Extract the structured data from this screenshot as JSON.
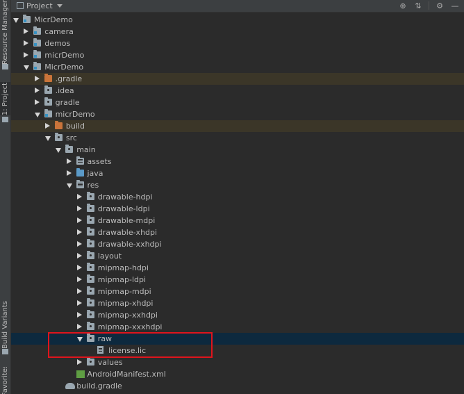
{
  "side_tabs": {
    "resource_manager": "Resource Manager",
    "project": "1: Project",
    "build_variants": "Build Variants",
    "favorites": "Favorites"
  },
  "header": {
    "title": "Project",
    "icons": [
      "crosshair-icon",
      "collapse-all-icon",
      "gear-icon"
    ]
  },
  "tree": [
    {
      "label": "MicrDemo",
      "icon": "module",
      "expanded": true
    },
    {
      "label": "camera",
      "icon": "module",
      "expanded": false
    },
    {
      "label": "demos",
      "icon": "module",
      "expanded": false
    },
    {
      "label": "micrDemo",
      "icon": "module",
      "expanded": false
    },
    {
      "label": "MicrDemo",
      "icon": "module",
      "expanded": true
    },
    {
      "label": ".gradle",
      "icon": "folder-excluded",
      "expanded": false
    },
    {
      "label": ".idea",
      "icon": "folder",
      "expanded": false
    },
    {
      "label": "gradle",
      "icon": "folder",
      "expanded": false
    },
    {
      "label": "micrDemo",
      "icon": "module",
      "expanded": true
    },
    {
      "label": "build",
      "icon": "folder-excluded",
      "expanded": false
    },
    {
      "label": "src",
      "icon": "folder",
      "expanded": true
    },
    {
      "label": "main",
      "icon": "folder",
      "expanded": true
    },
    {
      "label": "assets",
      "icon": "folder-resources",
      "expanded": false
    },
    {
      "label": "java",
      "icon": "folder-source",
      "expanded": false
    },
    {
      "label": "res",
      "icon": "folder-resources",
      "expanded": true
    },
    {
      "label": "drawable-hdpi",
      "icon": "folder",
      "expanded": false
    },
    {
      "label": "drawable-ldpi",
      "icon": "folder",
      "expanded": false
    },
    {
      "label": "drawable-mdpi",
      "icon": "folder",
      "expanded": false
    },
    {
      "label": "drawable-xhdpi",
      "icon": "folder",
      "expanded": false
    },
    {
      "label": "drawable-xxhdpi",
      "icon": "folder",
      "expanded": false
    },
    {
      "label": "layout",
      "icon": "folder",
      "expanded": false
    },
    {
      "label": "mipmap-hdpi",
      "icon": "folder",
      "expanded": false
    },
    {
      "label": "mipmap-ldpi",
      "icon": "folder",
      "expanded": false
    },
    {
      "label": "mipmap-mdpi",
      "icon": "folder",
      "expanded": false
    },
    {
      "label": "mipmap-xhdpi",
      "icon": "folder",
      "expanded": false
    },
    {
      "label": "mipmap-xxhdpi",
      "icon": "folder",
      "expanded": false
    },
    {
      "label": "mipmap-xxxhdpi",
      "icon": "folder",
      "expanded": false
    },
    {
      "label": "raw",
      "icon": "folder",
      "expanded": true,
      "selected": true
    },
    {
      "label": "license.lic",
      "icon": "file"
    },
    {
      "label": "values",
      "icon": "folder",
      "expanded": false
    },
    {
      "label": "AndroidManifest.xml",
      "icon": "xml-file"
    },
    {
      "label": "build.gradle",
      "icon": "gradle-file"
    }
  ],
  "colors": {
    "background": "#2b2b2b",
    "selection": "#0d293e",
    "excluded_row": "#3b3628",
    "highlight_box": "#e0141c"
  }
}
